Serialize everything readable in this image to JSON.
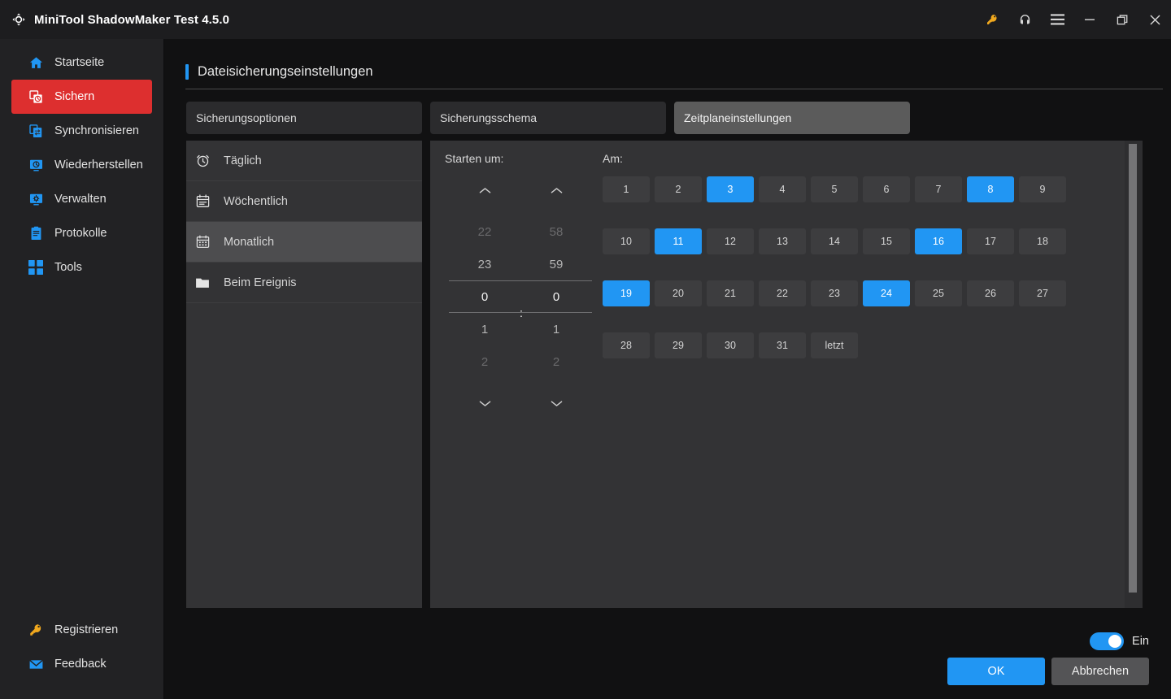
{
  "titlebar": {
    "app_title": "MiniTool ShadowMaker Test 4.5.0",
    "logo_icon": "shadowmaker-logo-icon",
    "controls": [
      {
        "name": "key-icon",
        "glyph": "key"
      },
      {
        "name": "headset-icon",
        "glyph": "headset"
      },
      {
        "name": "menu-icon",
        "glyph": "hamburger"
      },
      {
        "name": "minimize-icon",
        "glyph": "minimize"
      },
      {
        "name": "restore-icon",
        "glyph": "restore"
      },
      {
        "name": "close-icon",
        "glyph": "close"
      }
    ]
  },
  "sidebar": {
    "items": [
      {
        "label": "Startseite",
        "icon": "home-icon",
        "active": false
      },
      {
        "label": "Sichern",
        "icon": "backup-icon",
        "active": true
      },
      {
        "label": "Synchronisieren",
        "icon": "sync-icon",
        "active": false
      },
      {
        "label": "Wiederherstellen",
        "icon": "restore-icon",
        "active": false
      },
      {
        "label": "Verwalten",
        "icon": "manage-icon",
        "active": false
      },
      {
        "label": "Protokolle",
        "icon": "logs-icon",
        "active": false
      },
      {
        "label": "Tools",
        "icon": "tools-icon",
        "active": false
      }
    ],
    "bottom_items": [
      {
        "label": "Registrieren",
        "icon": "key-icon",
        "color": "gold"
      },
      {
        "label": "Feedback",
        "icon": "envelope-icon",
        "color": "blue"
      }
    ]
  },
  "page": {
    "title": "Dateisicherungseinstellungen",
    "accent_color": "#2196f3"
  },
  "tabs": [
    {
      "label": "Sicherungsoptionen",
      "active": false
    },
    {
      "label": "Sicherungsschema",
      "active": false
    },
    {
      "label": "Zeitplaneinstellungen",
      "active": true
    }
  ],
  "schedule_types": [
    {
      "label": "Täglich",
      "icon": "alarm-clock-icon",
      "selected": false
    },
    {
      "label": "Wöchentlich",
      "icon": "calendar-icon",
      "selected": false
    },
    {
      "label": "Monatlich",
      "icon": "calendar-grid-icon",
      "selected": true
    },
    {
      "label": "Beim Ereignis",
      "icon": "folder-icon",
      "selected": false
    }
  ],
  "time_picker": {
    "label": "Starten um:",
    "separator": ":",
    "hours": {
      "far_prev": "22",
      "near_prev": "23",
      "selected": "0",
      "near_next": "1",
      "far_next": "2"
    },
    "minutes": {
      "far_prev": "58",
      "near_prev": "59",
      "selected": "0",
      "near_next": "1",
      "far_next": "2"
    },
    "up_icon": "chevron-up-icon",
    "down_icon": "chevron-down-icon"
  },
  "day_picker": {
    "label": "Am:",
    "selected_color": "#2196f3",
    "days": [
      {
        "label": "1",
        "selected": false
      },
      {
        "label": "2",
        "selected": false
      },
      {
        "label": "3",
        "selected": true
      },
      {
        "label": "4",
        "selected": false
      },
      {
        "label": "5",
        "selected": false
      },
      {
        "label": "6",
        "selected": false
      },
      {
        "label": "7",
        "selected": false
      },
      {
        "label": "8",
        "selected": true
      },
      {
        "label": "9",
        "selected": false
      },
      {
        "label": "10",
        "selected": false
      },
      {
        "label": "11",
        "selected": true
      },
      {
        "label": "12",
        "selected": false
      },
      {
        "label": "13",
        "selected": false
      },
      {
        "label": "14",
        "selected": false
      },
      {
        "label": "15",
        "selected": false
      },
      {
        "label": "16",
        "selected": true
      },
      {
        "label": "17",
        "selected": false
      },
      {
        "label": "18",
        "selected": false
      },
      {
        "label": "19",
        "selected": true
      },
      {
        "label": "20",
        "selected": false
      },
      {
        "label": "21",
        "selected": false
      },
      {
        "label": "22",
        "selected": false
      },
      {
        "label": "23",
        "selected": false
      },
      {
        "label": "24",
        "selected": true
      },
      {
        "label": "25",
        "selected": false
      },
      {
        "label": "26",
        "selected": false
      },
      {
        "label": "27",
        "selected": false
      },
      {
        "label": "28",
        "selected": false
      },
      {
        "label": "29",
        "selected": false
      },
      {
        "label": "30",
        "selected": false
      },
      {
        "label": "31",
        "selected": false
      },
      {
        "label": "letzt",
        "selected": false
      }
    ]
  },
  "footer": {
    "toggle_label": "Ein",
    "toggle_on": true,
    "ok_label": "OK",
    "cancel_label": "Abbrechen"
  }
}
